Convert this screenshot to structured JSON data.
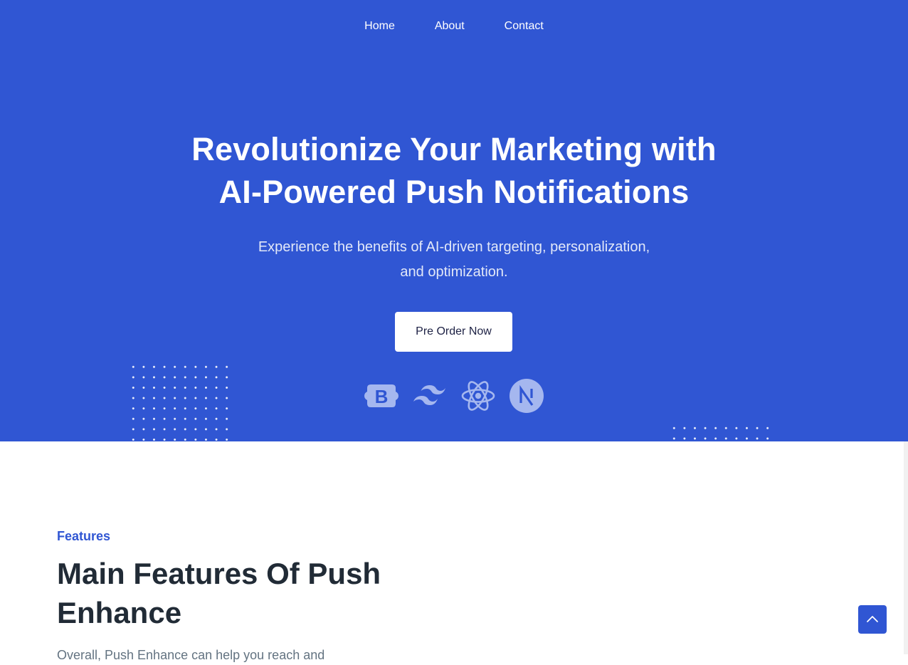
{
  "nav": {
    "items": [
      {
        "label": "Home"
      },
      {
        "label": "About"
      },
      {
        "label": "Contact"
      }
    ]
  },
  "hero": {
    "title_line1": "Revolutionize Your Marketing with",
    "title_line2": "AI-Powered Push Notifications",
    "subtitle_line1": "Experience the benefits of AI-driven targeting, personalization,",
    "subtitle_line2": "and optimization.",
    "cta_label": "Pre Order Now",
    "tech_icons": [
      "bootstrap-icon",
      "tailwind-icon",
      "react-icon",
      "nextjs-icon"
    ]
  },
  "features": {
    "tag": "Features",
    "title_line1": "Main Features Of Push",
    "title_line2": "Enhance",
    "description": "Overall, Push Enhance can help you reach and"
  },
  "colors": {
    "primary": "#3056d3",
    "heading": "#212b36",
    "body_text": "#637381"
  },
  "icons": {
    "back_to_top": "chevron-up-icon"
  }
}
